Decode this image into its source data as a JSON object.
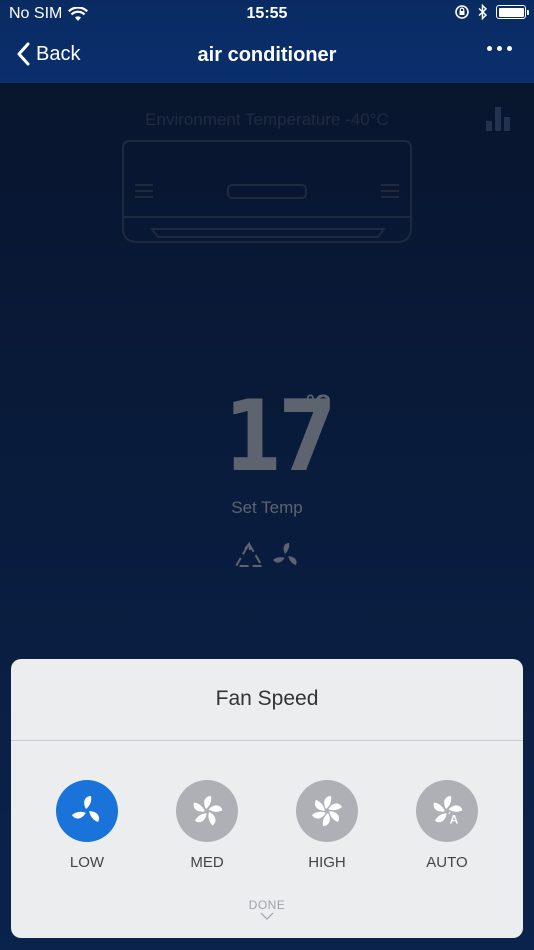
{
  "status_bar": {
    "carrier": "No SIM",
    "time": "15:55"
  },
  "nav": {
    "back_label": "Back",
    "title": "air conditioner"
  },
  "device": {
    "environment_temperature": "Environment Temperature -40°C",
    "set_temp_value": "17",
    "temp_unit": "°C",
    "set_temp_label": "Set Temp"
  },
  "fan_speed_sheet": {
    "title": "Fan Speed",
    "options": [
      {
        "label": "LOW",
        "selected": true
      },
      {
        "label": "MED",
        "selected": false
      },
      {
        "label": "HIGH",
        "selected": false
      },
      {
        "label": "AUTO",
        "selected": false
      }
    ],
    "done_label": "DONE"
  },
  "colors": {
    "accent": "#1a73d9",
    "nav_bar": "#0a2f6d",
    "inactive_option": "#aeb0b5"
  }
}
